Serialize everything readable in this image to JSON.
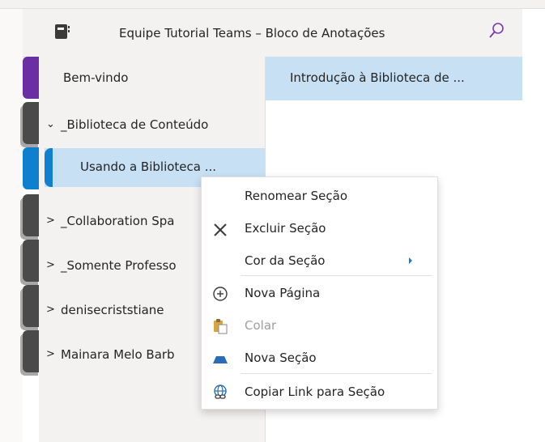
{
  "header": {
    "title": "Equipe Tutorial Teams – Bloco de Anotações",
    "search_icon": "search-icon",
    "notebook_icon": "notebook-icon"
  },
  "section_tabs": [
    {
      "color": "#6b2fa3"
    },
    {
      "color": "#4a4a4a"
    },
    {
      "color": "#0f7fcf"
    },
    {
      "color": "#4a4a4a"
    },
    {
      "color": "#4a4a4a"
    },
    {
      "color": "#4a4a4a"
    },
    {
      "color": "#4a4a4a"
    }
  ],
  "sections": {
    "items": [
      {
        "label": "Bem-vindo",
        "expandable": false
      },
      {
        "label": "_Biblioteca de Conteúdo",
        "expandable": true,
        "expanded": true
      },
      {
        "label": "Usando a Biblioteca ...",
        "selected": true
      },
      {
        "label": "_Collaboration Spa",
        "expandable": true
      },
      {
        "label": "_Somente Professo",
        "expandable": true
      },
      {
        "label": "denisecriststiane",
        "expandable": true
      },
      {
        "label": "Mainara Melo Barb",
        "expandable": true
      }
    ]
  },
  "pages": {
    "items": [
      {
        "label": "Introdução à Biblioteca de ..."
      }
    ]
  },
  "context_menu": {
    "items": [
      {
        "label": "Renomear Seção",
        "icon": "",
        "disabled": false
      },
      {
        "label": "Excluir Seção",
        "icon": "close-icon",
        "disabled": false
      },
      {
        "label": "Cor da Seção",
        "icon": "",
        "disabled": false,
        "submenu": true
      },
      {
        "label": "Nova Página",
        "icon": "add-circle-icon",
        "disabled": false
      },
      {
        "label": "Colar",
        "icon": "paste-icon",
        "disabled": true
      },
      {
        "label": "Nova Seção",
        "icon": "new-section-icon",
        "disabled": false
      },
      {
        "label": "Copiar Link para Seção",
        "icon": "link-icon",
        "disabled": false
      }
    ]
  },
  "colors": {
    "selection": "#c7e0f4",
    "accent": "#0f7fcf",
    "purple_tab": "#6b2fa3"
  }
}
